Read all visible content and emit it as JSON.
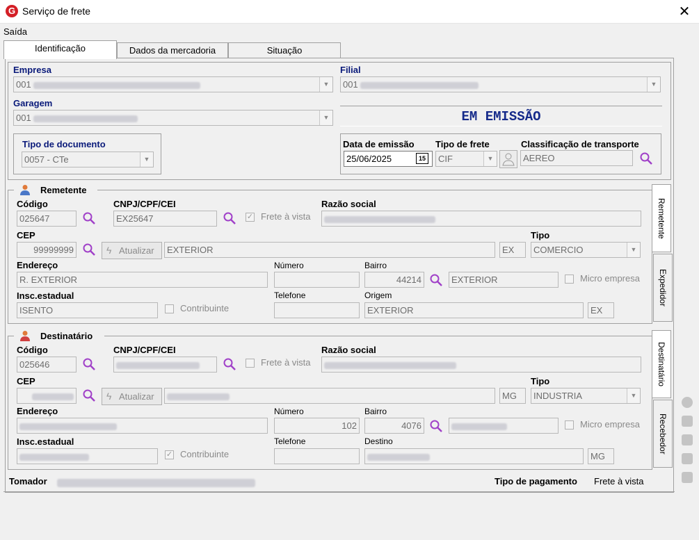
{
  "window": {
    "title": "Serviço de frete",
    "logo_letter": "G",
    "close": "✕"
  },
  "menu": {
    "saida": "Saída"
  },
  "tabs": [
    "Identificação",
    "Dados da mercadoria",
    "Situação"
  ],
  "header": {
    "empresa_label": "Empresa",
    "empresa_value": "001",
    "filial_label": "Filial",
    "filial_value": "001",
    "garagem_label": "Garagem",
    "garagem_value": "001",
    "status": "EM EMISSÃO",
    "tipo_doc_label": "Tipo de documento",
    "tipo_doc_value": "0057 - CTe",
    "data_emissao_label": "Data de emissão",
    "data_emissao_value": "25/06/2025",
    "calendar_day": "15",
    "tipo_frete_label": "Tipo de frete",
    "tipo_frete_value": "CIF",
    "classif_label": "Classificação de transporte",
    "classif_value": "AEREO"
  },
  "remetente": {
    "title": "Remetente",
    "codigo_label": "Código",
    "codigo_value": "025647",
    "cnpj_label": "CNPJ/CPF/CEI",
    "cnpj_value": "EX25647",
    "frete_vista": "Frete à vista",
    "razao_label": "Razão social",
    "cep_label": "CEP",
    "cep_value": "99999999",
    "atualizar": "Atualizar",
    "cidade_value": "EXTERIOR",
    "uf_value": "EX",
    "tipo_label": "Tipo",
    "tipo_value": "COMERCIO",
    "endereco_label": "Endereço",
    "endereco_value": "R. EXTERIOR",
    "numero_label": "Número",
    "bairro_label": "Bairro",
    "bairro_code": "44214",
    "bairro_value": "EXTERIOR",
    "micro": "Micro empresa",
    "insc_label": "Insc.estadual",
    "insc_value": "ISENTO",
    "contribuinte": "Contribuinte",
    "telefone_label": "Telefone",
    "origem_label": "Origem",
    "origem_value": "EXTERIOR",
    "origem_uf": "EX"
  },
  "destinatario": {
    "title": "Destinatário",
    "codigo_label": "Código",
    "codigo_value": "025646",
    "cnpj_label": "CNPJ/CPF/CEI",
    "frete_vista": "Frete à vista",
    "razao_label": "Razão social",
    "cep_label": "CEP",
    "atualizar": "Atualizar",
    "uf_value": "MG",
    "tipo_label": "Tipo",
    "tipo_value": "INDUSTRIA",
    "endereco_label": "Endereço",
    "numero_label": "Número",
    "numero_value": "102",
    "bairro_label": "Bairro",
    "bairro_code": "4076",
    "micro": "Micro empresa",
    "insc_label": "Insc.estadual",
    "contribuinte": "Contribuinte",
    "telefone_label": "Telefone",
    "destino_label": "Destino",
    "destino_uf": "MG"
  },
  "side_tabs": [
    "Remetente",
    "Expedidor",
    "Destinatário",
    "Recebedor"
  ],
  "footer": {
    "tomador_label": "Tomador",
    "pagamento_label": "Tipo de pagamento",
    "pagamento_value": "Frete à vista"
  },
  "colors": {
    "accent": "#a040c8",
    "navy_label": "#0a1a7a",
    "status": "#152a8a"
  },
  "icons": [
    "app-logo-icon",
    "close-icon",
    "search-icon",
    "calendar-icon",
    "person-icon",
    "lightning-icon",
    "checkbox-icon",
    "dropdown-arrow-icon"
  ]
}
